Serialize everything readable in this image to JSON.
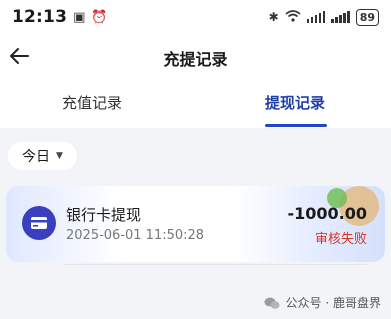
{
  "status_bar": {
    "time": "12:13",
    "battery": "89"
  },
  "nav": {
    "title": "充提记录"
  },
  "tabs": [
    {
      "label": "充值记录",
      "active": false
    },
    {
      "label": "提现记录",
      "active": true
    }
  ],
  "filter": {
    "label": "今日"
  },
  "records": [
    {
      "title": "银行卡提现",
      "time": "2025-06-01 11:50:28",
      "amount": "-1000.00",
      "status": "审核失败",
      "status_color": "#d0362a"
    }
  ],
  "watermark": {
    "text": "公众号 · 鹿哥盘界"
  },
  "colors": {
    "accent": "#2147c4",
    "icon_bg": "#3a3fbf"
  }
}
